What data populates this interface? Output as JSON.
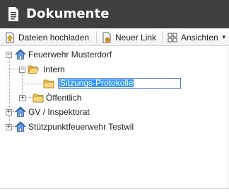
{
  "window": {
    "title": "Dokumente",
    "title_icon": "document-icon"
  },
  "toolbar": {
    "upload_label": "Dateien hochladen",
    "new_link_label": "Neuer Link",
    "views_label": "Ansichten"
  },
  "tree": {
    "root1": {
      "label": "Feuerwehr Musterdorf",
      "expander": "−"
    },
    "intern": {
      "label": "Intern",
      "expander": "−"
    },
    "editing": {
      "value": "Sitzungs-Protokolle"
    },
    "oeffentlich": {
      "label": "Öffentlich",
      "expander": "+"
    },
    "gv": {
      "label": "GV / Inspektorat",
      "expander": "+"
    },
    "stuetzpunkt": {
      "label": "Stützpunktfeuerwehr Testwil",
      "expander": "+"
    }
  },
  "colors": {
    "titlebar": "#3f3f3f",
    "selection": "#3399ff",
    "folder": "#f2c94c"
  }
}
